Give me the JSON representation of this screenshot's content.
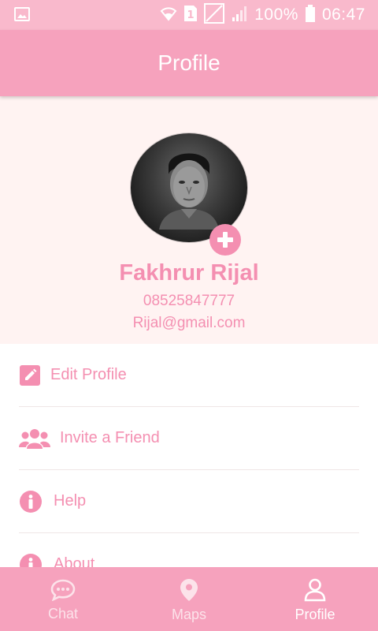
{
  "status_bar": {
    "sim_label": "1",
    "battery_percent": "100%",
    "time": "06:47"
  },
  "app_bar": {
    "title": "Profile"
  },
  "profile": {
    "name": "Fakhrur Rijal",
    "phone": "08525847777",
    "email": "Rijal@gmail.com"
  },
  "menu": {
    "items": [
      {
        "label": "Edit Profile",
        "icon": "edit-icon"
      },
      {
        "label": "Invite a Friend",
        "icon": "users-icon"
      },
      {
        "label": "Help",
        "icon": "info-icon"
      },
      {
        "label": "About",
        "icon": "info-icon"
      }
    ]
  },
  "bottom_nav": {
    "items": [
      {
        "label": "Chat",
        "icon": "chat-icon",
        "active": false
      },
      {
        "label": "Maps",
        "icon": "map-pin-icon",
        "active": false
      },
      {
        "label": "Profile",
        "icon": "user-icon",
        "active": true
      }
    ]
  },
  "colors": {
    "status_bar": "#f9b9cc",
    "app_bar": "#f6a2bd",
    "accent": "#f48fb1",
    "header_background": "#fff3f2"
  }
}
